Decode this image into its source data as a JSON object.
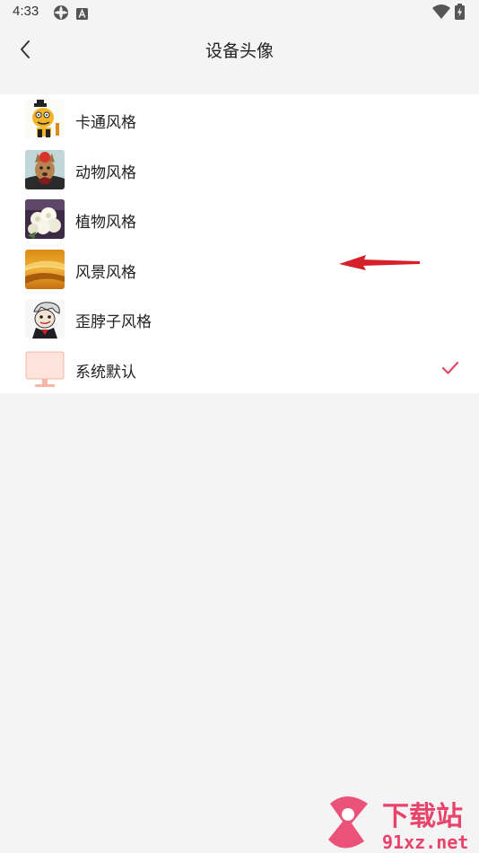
{
  "status_bar": {
    "time": "4:33",
    "icons": [
      "settings-circle-icon",
      "a-box-icon",
      "wifi-icon",
      "battery-charging-icon"
    ]
  },
  "header": {
    "title": "设备头像",
    "back_icon": "chevron-left-icon"
  },
  "avatar_styles": [
    {
      "label": "卡通风格",
      "thumb": "cartoon",
      "selected": false
    },
    {
      "label": "动物风格",
      "thumb": "animal",
      "selected": false
    },
    {
      "label": "植物风格",
      "thumb": "plant",
      "selected": false
    },
    {
      "label": "风景风格",
      "thumb": "scenery",
      "selected": false
    },
    {
      "label": "歪脖子风格",
      "thumb": "crooked-neck",
      "selected": false
    },
    {
      "label": "系统默认",
      "thumb": "monitor",
      "selected": true
    }
  ],
  "colors": {
    "accent": "#e8436b",
    "background": "#f4f4f5",
    "annotation_arrow": "#d6202a"
  },
  "watermark": {
    "brand_text": "下载站",
    "domain_text": "91xz.net"
  }
}
